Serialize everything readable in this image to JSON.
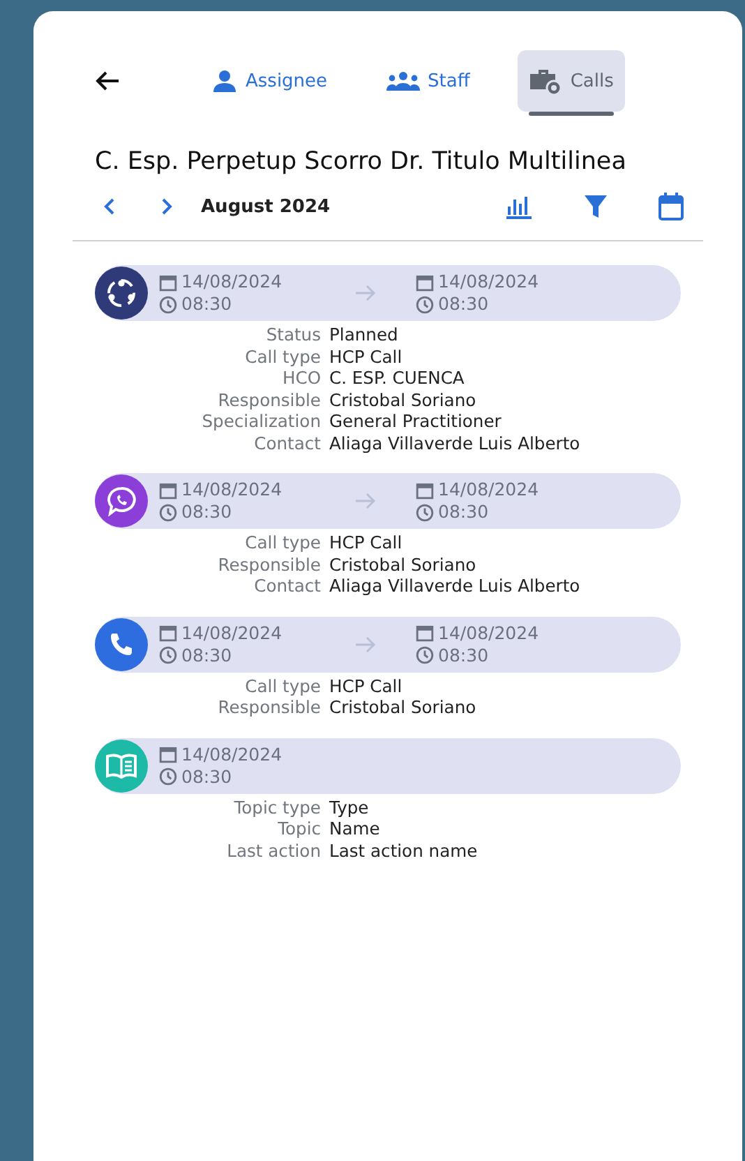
{
  "tabs": [
    {
      "label": "Assignee",
      "kind": "person",
      "selected": false
    },
    {
      "label": "Staff",
      "kind": "group",
      "selected": false
    },
    {
      "label": "Calls",
      "kind": "briefcase",
      "selected": true
    }
  ],
  "title": "C. Esp. Perpetup Scorro Dr. Titulo Multilinea",
  "period": "August 2024",
  "calls": [
    {
      "kind": "meeting",
      "color": "#2e3b78",
      "start": {
        "date": "14/08/2024",
        "time": "08:30"
      },
      "end": {
        "date": "14/08/2024",
        "time": "08:30"
      },
      "fields": [
        {
          "label": "Status",
          "value": "Planned"
        },
        {
          "label": "Call type",
          "value": "HCP Call"
        },
        {
          "label": "HCO",
          "value": "C. ESP. CUENCA"
        },
        {
          "label": "Responsible",
          "value": "Cristobal Soriano"
        },
        {
          "label": "Specialization",
          "value": "General Practitioner"
        },
        {
          "label": "Contact",
          "value": "Aliaga Villaverde Luis Alberto"
        }
      ]
    },
    {
      "kind": "chat",
      "color": "#8b3fd8",
      "start": {
        "date": "14/08/2024",
        "time": "08:30"
      },
      "end": {
        "date": "14/08/2024",
        "time": "08:30"
      },
      "fields": [
        {
          "label": "Call type",
          "value": "HCP Call"
        },
        {
          "label": "Responsible",
          "value": "Cristobal Soriano"
        },
        {
          "label": "Contact",
          "value": "Aliaga Villaverde Luis Alberto"
        }
      ]
    },
    {
      "kind": "phone",
      "color": "#2d6de0",
      "start": {
        "date": "14/08/2024",
        "time": "08:30"
      },
      "end": {
        "date": "14/08/2024",
        "time": "08:30"
      },
      "fields": [
        {
          "label": "Call type",
          "value": "HCP Call"
        },
        {
          "label": "Responsible",
          "value": "Cristobal Soriano"
        }
      ]
    },
    {
      "kind": "training",
      "color": "#1dbaa8",
      "start": {
        "date": "14/08/2024",
        "time": "08:30"
      },
      "fields": [
        {
          "label": "Topic type",
          "value": "Type"
        },
        {
          "label": "Topic",
          "value": "Name"
        },
        {
          "label": "Last action",
          "value": "Last action name"
        }
      ]
    }
  ]
}
